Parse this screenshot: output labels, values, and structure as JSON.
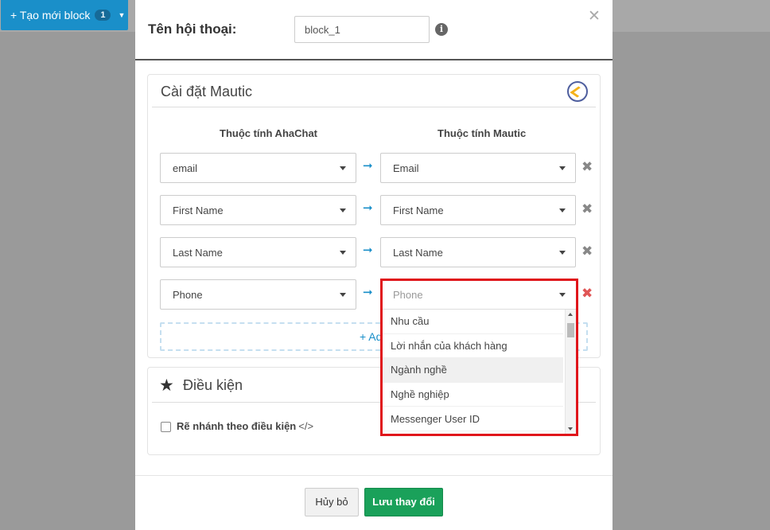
{
  "topbar": {
    "create_label": "+ Tạo mới block",
    "badge": "1"
  },
  "modal": {
    "title": "Tên hội thoại:",
    "name_value": "block_1",
    "info_icon": "info-circle-icon",
    "close_icon": "close-icon"
  },
  "mautic": {
    "title": "Cài đặt Mautic",
    "col_left": "Thuộc tính AhaChat",
    "col_right": "Thuộc tính Mautic",
    "rows": [
      {
        "left": "email",
        "right": "Email"
      },
      {
        "left": "First Name",
        "right": "First Name"
      },
      {
        "left": "Last Name",
        "right": "Last Name"
      },
      {
        "left": "Phone",
        "right": "Phone"
      }
    ],
    "add_label": "+ Ad"
  },
  "dropdown": {
    "placeholder": "Phone",
    "options": [
      "Nhu cầu",
      "Lời nhắn của khách hàng",
      "Ngành nghề",
      "Nghề nghiệp",
      "Messenger User ID"
    ],
    "highlighted": "Ngành nghề"
  },
  "condition": {
    "title": "Điều kiện",
    "checkbox_label": "Rẽ nhánh theo điều kiện",
    "code_glyph": "</>"
  },
  "footer": {
    "cancel": "Hủy bỏ",
    "save": "Lưu thay đổi"
  },
  "colors": {
    "accent": "#1a8fc9",
    "save": "#1aa15a",
    "highlight": "#e0151b",
    "delete_active": "#e05555"
  }
}
